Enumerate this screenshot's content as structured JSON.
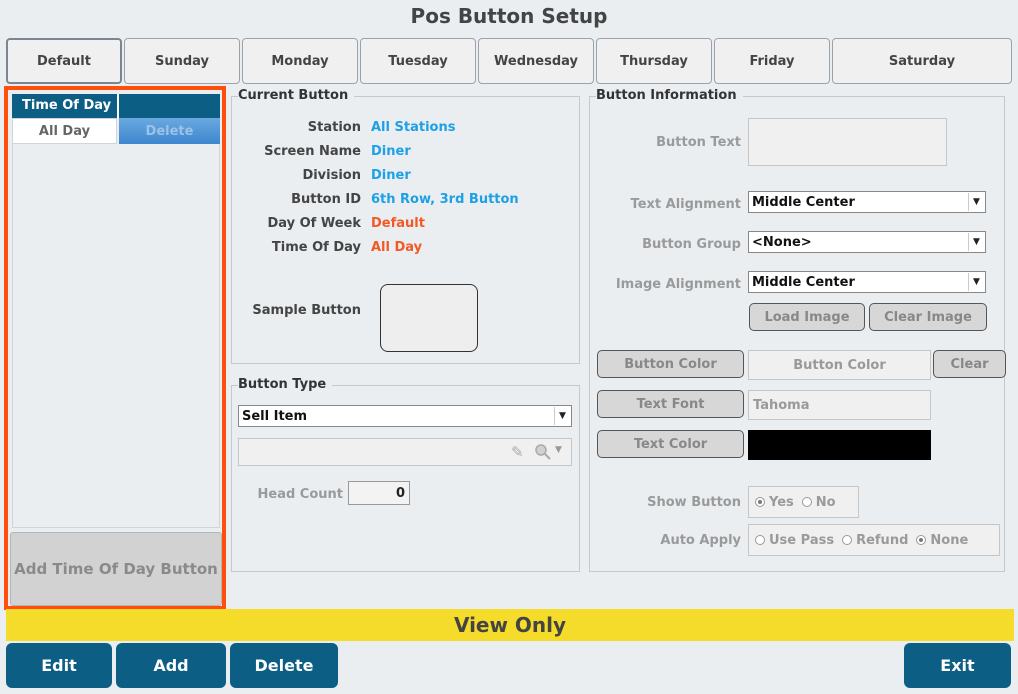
{
  "title": "Pos Button Setup",
  "days": [
    "Default",
    "Sunday",
    "Monday",
    "Tuesday",
    "Wednesday",
    "Thursday",
    "Friday",
    "Saturday"
  ],
  "time_of_day": {
    "header": "Time Of Day",
    "rows": [
      {
        "name": "All Day",
        "action": "Delete"
      }
    ],
    "add_button": "Add Time Of Day Button"
  },
  "current_button": {
    "title": "Current Button",
    "station_label": "Station",
    "station": "All Stations",
    "screen_label": "Screen Name",
    "screen": "Diner",
    "division_label": "Division",
    "division": "Diner",
    "button_id_label": "Button ID",
    "button_id": "6th Row, 3rd Button",
    "day_label": "Day Of Week",
    "day": "Default",
    "tod_label": "Time Of Day",
    "tod": "All Day",
    "sample_label": "Sample Button"
  },
  "button_type": {
    "title": "Button Type",
    "type_value": "Sell Item",
    "head_count_label": "Head Count",
    "head_count": "0"
  },
  "button_info": {
    "title": "Button Information",
    "button_text_label": "Button Text",
    "text_alignment_label": "Text Alignment",
    "text_alignment": "Middle Center",
    "button_group_label": "Button Group",
    "button_group": "<None>",
    "image_alignment_label": "Image Alignment",
    "image_alignment": "Middle Center",
    "load_image": "Load Image",
    "clear_image": "Clear Image",
    "button_color_btn": "Button Color",
    "button_color_value": "Button Color",
    "clear": "Clear",
    "text_font_btn": "Text Font",
    "text_font_value": "Tahoma",
    "text_color_btn": "Text Color",
    "text_color_swatch": "#000000",
    "show_button_label": "Show Button",
    "show_yes": "Yes",
    "show_no": "No",
    "auto_apply_label": "Auto Apply",
    "use_pass": "Use Pass",
    "refund": "Refund",
    "none": "None"
  },
  "banner": "View Only",
  "actions": {
    "edit": "Edit",
    "add": "Add",
    "delete": "Delete",
    "exit": "Exit"
  }
}
